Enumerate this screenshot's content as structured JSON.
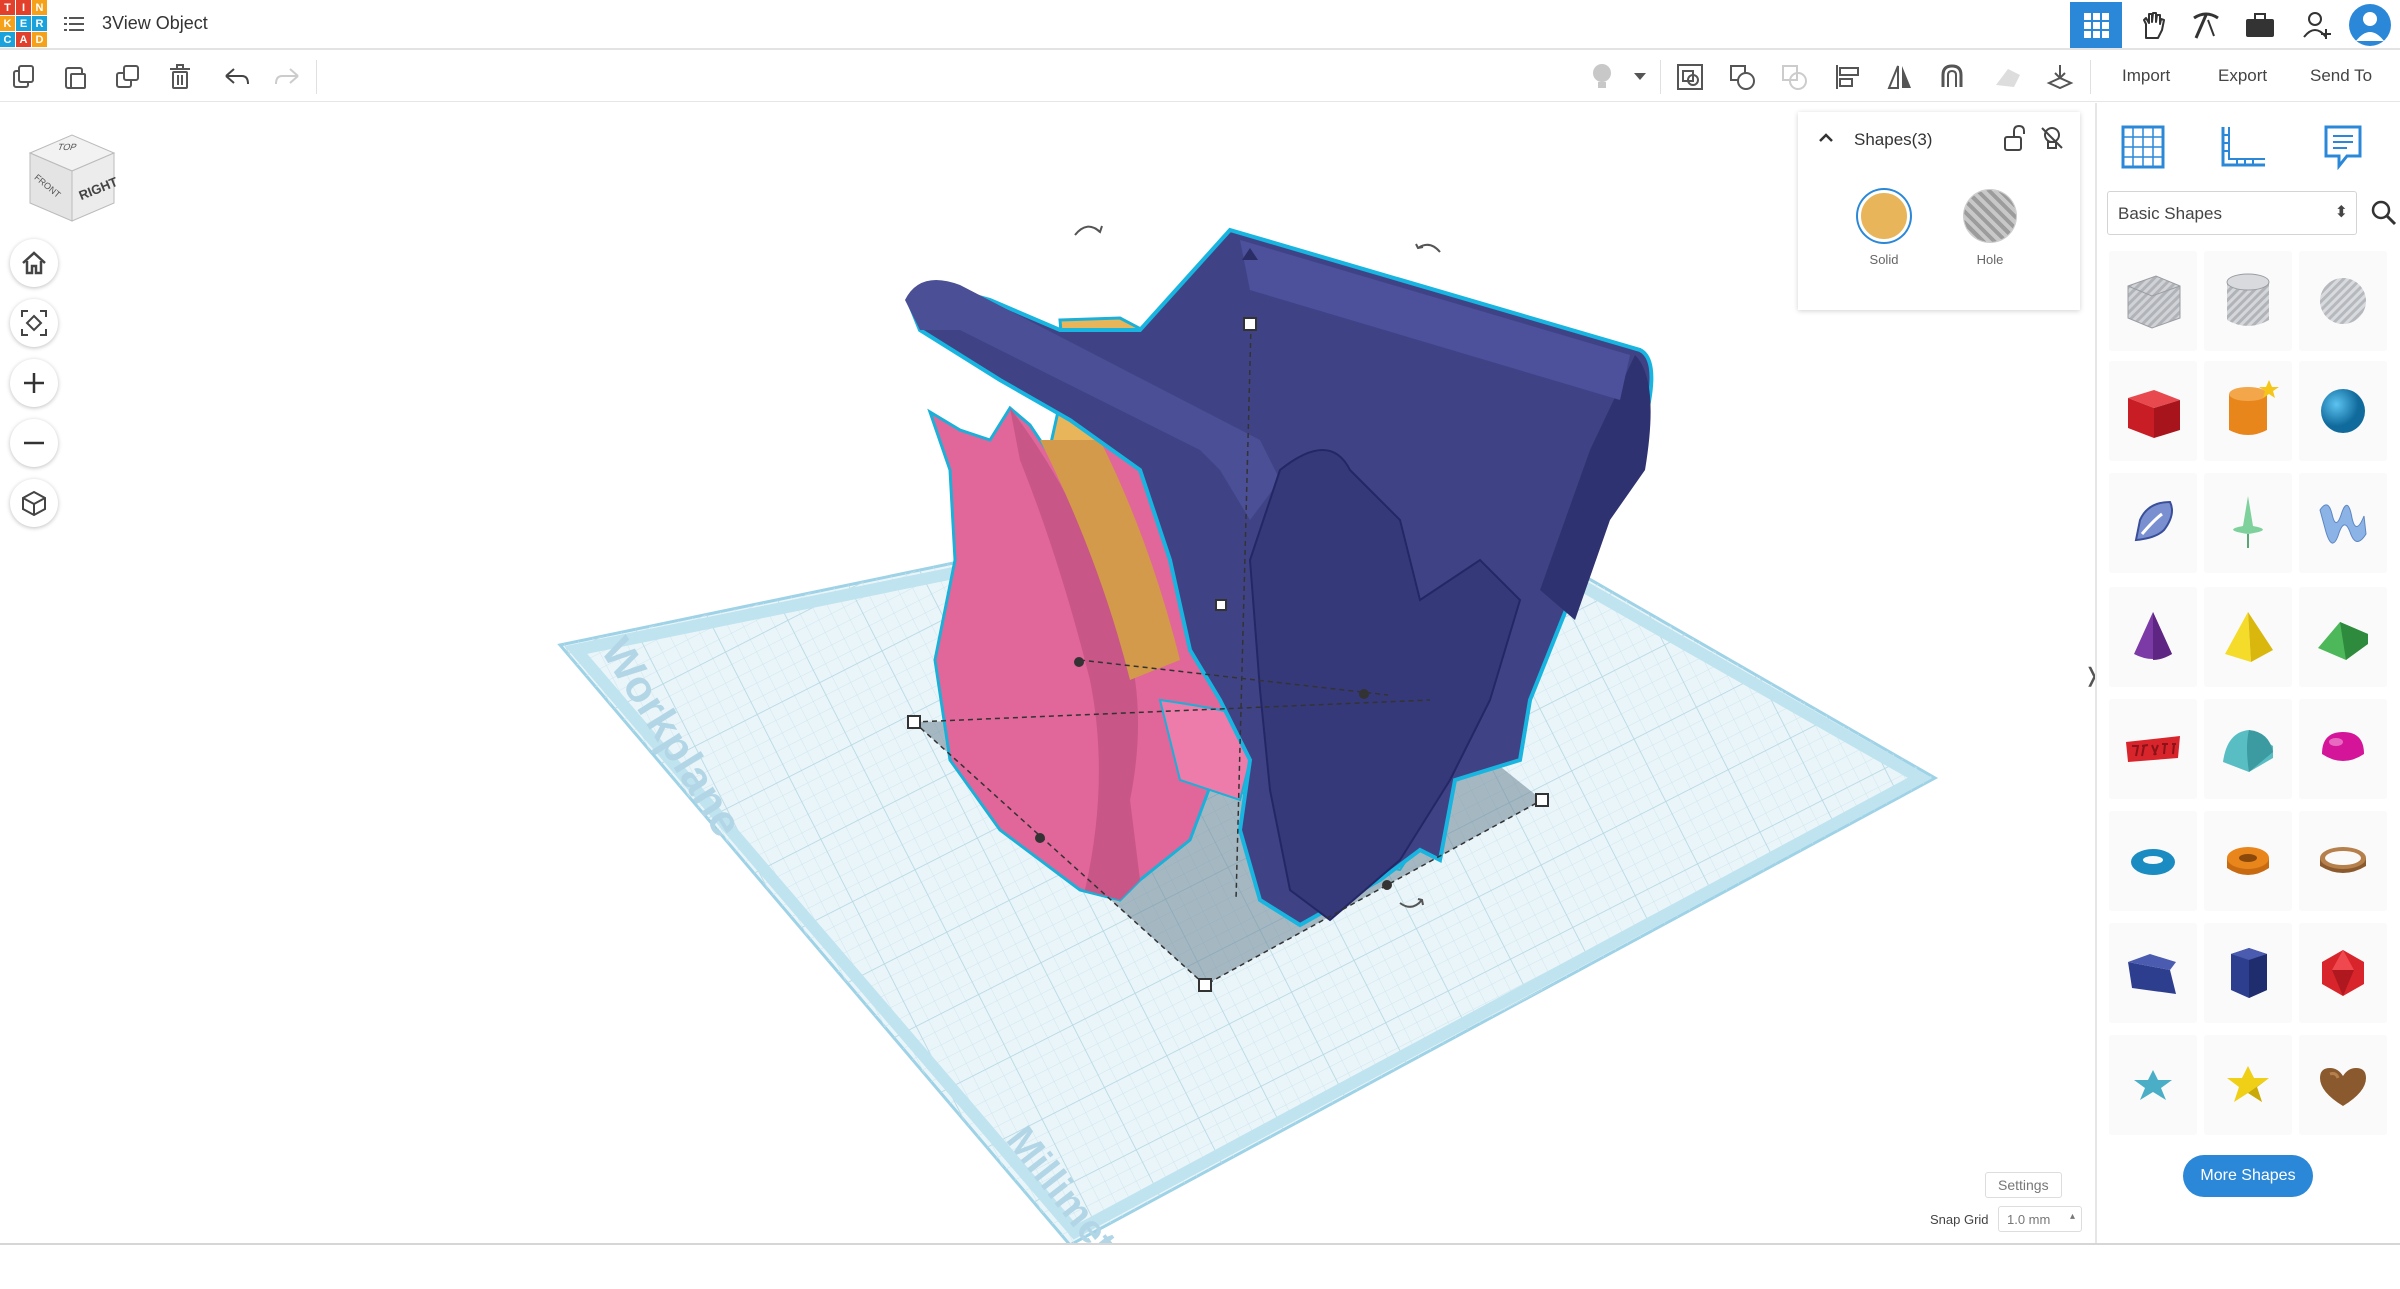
{
  "app": {
    "logo_letters": [
      "T",
      "I",
      "N",
      "K",
      "E",
      "R",
      "C",
      "A",
      "D"
    ],
    "logo_colors": [
      "#e2402a",
      "#e2402a",
      "#f6a11a",
      "#f6a11a",
      "#1aa2dc",
      "#1aa2dc",
      "#1aa2dc",
      "#e2402a",
      "#f6a11a"
    ],
    "document_title": "3View Object",
    "menu_icon": "list-icon"
  },
  "top_icons": [
    {
      "name": "grid-view-icon",
      "active": true
    },
    {
      "name": "hand-icon",
      "active": false
    },
    {
      "name": "pickaxe-icon",
      "active": false
    },
    {
      "name": "briefcase-icon",
      "active": false
    },
    {
      "name": "add-user-icon",
      "active": false
    },
    {
      "name": "user-avatar-icon",
      "active": false
    }
  ],
  "toolbar": {
    "left_tools": [
      "copy-icon",
      "paste-icon",
      "duplicate-icon",
      "delete-icon",
      "undo-icon",
      "redo-icon"
    ],
    "right_tools": [
      "light-bulb-icon",
      "dropdown-arrow-icon",
      "group-icon",
      "ungroup-icon",
      "cutout-icon",
      "align-icon",
      "mirror-icon",
      "magnet-icon",
      "cruise-icon",
      "drop-icon"
    ],
    "import_label": "Import",
    "export_label": "Export",
    "sendto_label": "Send To"
  },
  "view_cube": {
    "top_label": "TOP",
    "front_label": "FRONT",
    "right_label": "RIGHT"
  },
  "view_controls": [
    "home-icon",
    "fit-view-icon",
    "zoom-in-icon",
    "zoom-out-icon",
    "perspective-icon"
  ],
  "workplane": {
    "label": "Workplane",
    "units_label": "Millimeters"
  },
  "inspector": {
    "title": "Shapes(3)",
    "solid_label": "Solid",
    "hole_label": "Hole",
    "solid_color": "#e8b55a"
  },
  "panel": {
    "tabs": [
      "grid-panel-icon",
      "ruler-icon",
      "notes-icon"
    ],
    "category": "Basic Shapes",
    "shapes": [
      {
        "name": "box-hole-shape",
        "color": "#b9bcc1"
      },
      {
        "name": "cylinder-hole-shape",
        "color": "#c0c3c8"
      },
      {
        "name": "sphere-hole-shape",
        "color": "#c6c8cc"
      },
      {
        "name": "box-shape",
        "color": "#d8242b"
      },
      {
        "name": "cylinder-shape",
        "color": "#e8861c"
      },
      {
        "name": "sphere-shape",
        "color": "#1a8cc2"
      },
      {
        "name": "scribble-shape",
        "color": "#7a8fcf"
      },
      {
        "name": "graphic-shape",
        "color": "#7fd19b"
      },
      {
        "name": "wave-shape",
        "color": "#7fa7e0"
      },
      {
        "name": "cone-shape",
        "color": "#7b3aa5"
      },
      {
        "name": "pyramid-shape",
        "color": "#f0d017"
      },
      {
        "name": "roof-shape",
        "color": "#3ca04a"
      },
      {
        "name": "text-shape",
        "color": "#d8242b"
      },
      {
        "name": "round-roof-shape",
        "color": "#59bec4"
      },
      {
        "name": "half-sphere-shape",
        "color": "#d4159a"
      },
      {
        "name": "torus-shape",
        "color": "#1a8cc2"
      },
      {
        "name": "tube-shape",
        "color": "#e8861c"
      },
      {
        "name": "ring-shape",
        "color": "#b5804b"
      },
      {
        "name": "wedge-shape",
        "color": "#2e3e8e"
      },
      {
        "name": "polygon-shape",
        "color": "#2e3e8e"
      },
      {
        "name": "icosahedron-shape",
        "color": "#d8242b"
      },
      {
        "name": "star-shape",
        "color": "#4aaec7"
      },
      {
        "name": "star-yellow-shape",
        "color": "#f0d017"
      },
      {
        "name": "heart-shape",
        "color": "#8a5a2e"
      }
    ],
    "more_shapes_label": "More Shapes"
  },
  "bottom": {
    "settings_label": "Settings",
    "snap_grid_label": "Snap Grid",
    "snap_grid_value": "1.0 mm"
  },
  "colors": {
    "accent": "#2b88d8",
    "navy": "#3f4386",
    "pink": "#e1669a",
    "tan": "#e8b55a",
    "grid": "#d5ecf3",
    "selection": "#18b5e0"
  }
}
